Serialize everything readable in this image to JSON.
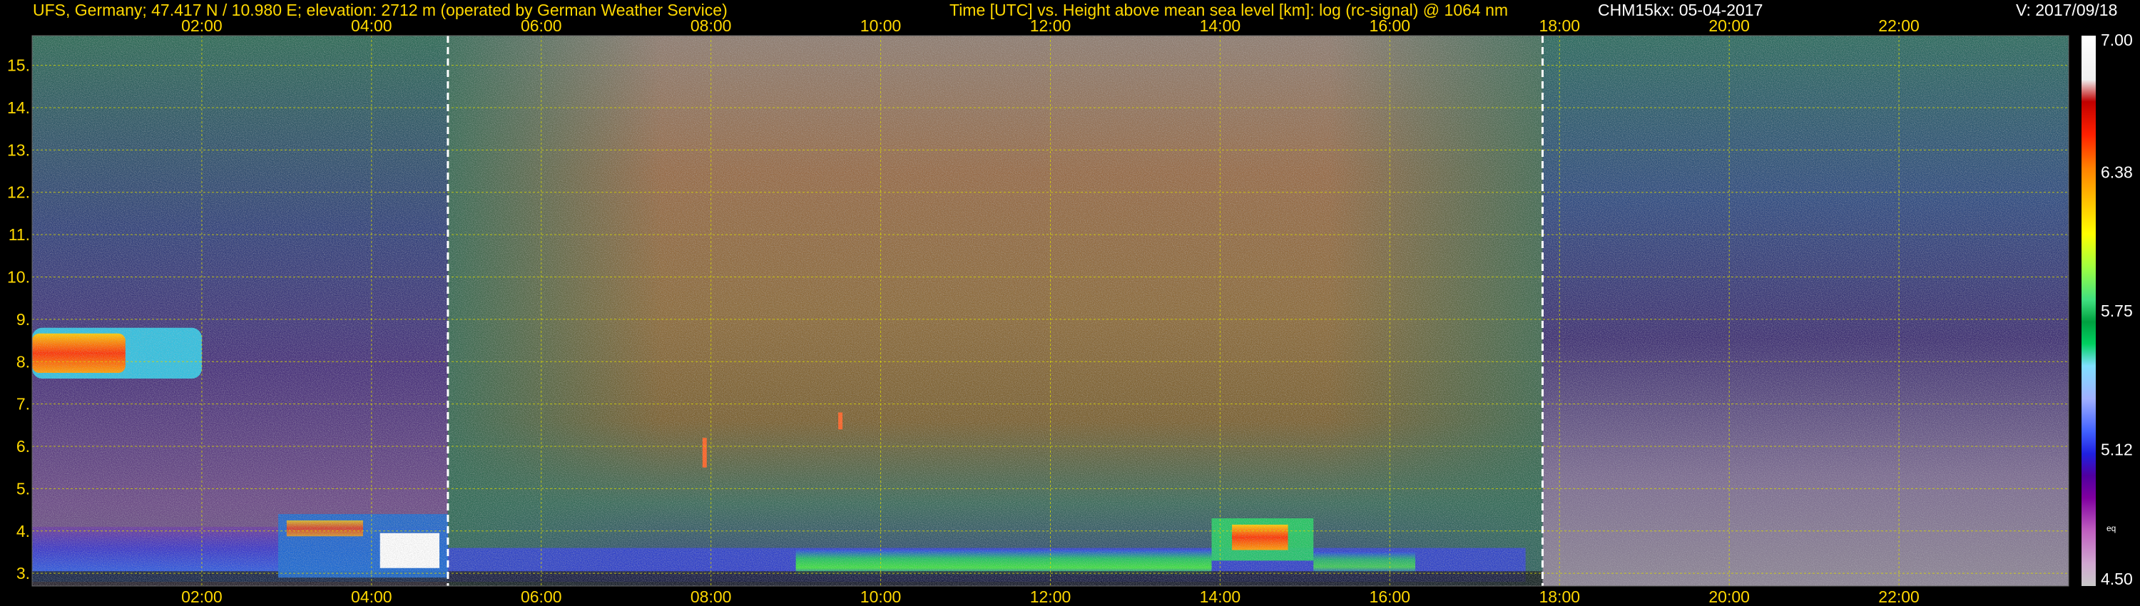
{
  "header": {
    "station": "UFS, Germany; 47.417 N / 10.980 E; elevation: 2712 m  (operated by German Weather Service)",
    "axis_title": "Time [UTC] vs. Height above mean sea level [km]: log (rc-signal) @ 1064 nm",
    "instrument": "CHM15kx: 05-04-2017",
    "version": "V: 2017/09/18"
  },
  "colors": {
    "header_text": "#ffd800",
    "grid": "#d8d800",
    "background": "#000000"
  },
  "chart_data": {
    "type": "heatmap",
    "title": "Time [UTC] vs. Height above mean sea level [km]: log (rc-signal) @ 1064 nm",
    "x_range_hours": [
      0.0,
      24.0
    ],
    "x_ticks": [
      "02:00",
      "04:00",
      "06:00",
      "08:00",
      "10:00",
      "12:00",
      "14:00",
      "16:00",
      "18:00",
      "20:00",
      "22:00"
    ],
    "x_tick_hours": [
      2,
      4,
      6,
      8,
      10,
      12,
      14,
      16,
      18,
      20,
      22
    ],
    "y_range_km": [
      2.7,
      15.7
    ],
    "y_ticks": [
      "3.",
      "4.",
      "5.",
      "6.",
      "7.",
      "8.",
      "9.",
      "10.",
      "11.",
      "12.",
      "13.",
      "14.",
      "15."
    ],
    "y_tick_values": [
      3,
      4,
      5,
      6,
      7,
      8,
      9,
      10,
      11,
      12,
      13,
      14,
      15
    ],
    "colorbar_range": [
      4.5,
      7.0
    ],
    "colorbar_ticks": [
      "7.00",
      "6.38",
      "5.75",
      "5.12",
      "4.50"
    ],
    "colorbar_tick_values": [
      7.0,
      6.38,
      5.75,
      5.12,
      4.5
    ],
    "colorbar_side_label": "eq",
    "day_markers_hours": [
      4.9,
      17.8
    ],
    "features": [
      {
        "kind": "cloud",
        "t": [
          0.0,
          2.0
        ],
        "h": [
          7.6,
          8.8
        ]
      },
      {
        "kind": "cloud",
        "t": [
          2.9,
          4.9
        ],
        "h": [
          2.9,
          4.4
        ]
      },
      {
        "kind": "boundary_layer",
        "t": [
          0.0,
          17.8
        ],
        "h": [
          2.8,
          4.1
        ]
      },
      {
        "kind": "convective",
        "t": [
          13.9,
          15.1
        ],
        "h": [
          3.3,
          4.3
        ]
      },
      {
        "kind": "plume",
        "t": [
          7.9,
          7.95
        ],
        "h": [
          5.5,
          6.2
        ]
      },
      {
        "kind": "plume",
        "t": [
          9.5,
          9.55
        ],
        "h": [
          6.4,
          6.8
        ]
      }
    ]
  }
}
